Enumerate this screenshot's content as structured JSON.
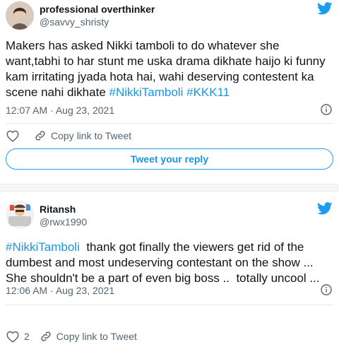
{
  "tweets": [
    {
      "name": "professional overthinker",
      "handle": "@savvy_shristy",
      "text": "Makers has asked Nikki tamboli to do whatever she want,tabhi to har stunt me uska drama dikhate haijo ki funny kam irritating jyada hota hai, wahi deserving contestent ka scene nahi dikhate ",
      "hashtags": [
        "#NikkiTamboli",
        "#KKK11"
      ],
      "timestamp": "12:07 AM · Aug 23, 2021",
      "like_count": "",
      "copy_link_label": "Copy link to Tweet",
      "reply_button_label": "Tweet your reply"
    },
    {
      "name": "Ritansh",
      "handle": "@rwx1990",
      "hashtag_lead": "#NikkiTamboli",
      "text": "  thank got finally the viewers get rid of the dumbest and most undeserving contestant on the show ... She shouldn't be a part of even big boss ..  totally uncool ...",
      "timestamp": "12:06 AM · Aug 23, 2021",
      "like_count": "2",
      "copy_link_label": "Copy link to Tweet"
    }
  ],
  "colors": {
    "twitter_blue": "#1d9bf0",
    "hashtag_blue": "#1b95e0",
    "meta_gray": "#536471"
  },
  "icons": [
    "twitter-bird-icon",
    "heart-icon",
    "link-icon",
    "info-icon"
  ]
}
